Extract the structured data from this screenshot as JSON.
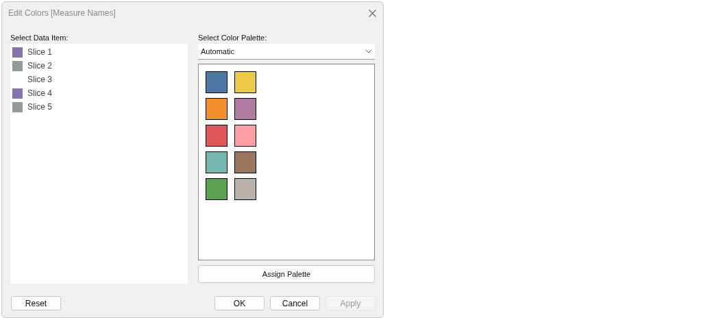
{
  "window": {
    "title": "Edit Colors [Measure Names]"
  },
  "data_items": {
    "label": "Select Data Item:",
    "items": [
      {
        "name": "Slice 1",
        "color": "#8175aa"
      },
      {
        "name": "Slice 2",
        "color": "#949a9b"
      },
      {
        "name": "Slice 3"
      },
      {
        "name": "Slice 4",
        "color": "#8175aa"
      },
      {
        "name": "Slice 5",
        "color": "#949a9b"
      }
    ]
  },
  "palette": {
    "label": "Select Color Palette:",
    "value": "Automatic",
    "swatches": [
      {
        "color": "#4e79a7"
      },
      {
        "color": "#edc948"
      },
      {
        "color": "#f28e2b"
      },
      {
        "color": "#b07aa1"
      },
      {
        "color": "#e15759"
      },
      {
        "color": "#ff9da7"
      },
      {
        "color": "#76b7b2"
      },
      {
        "color": "#9c755f"
      },
      {
        "color": "#59a14f"
      },
      {
        "color": "#bab0ac"
      }
    ],
    "assign_button": "Assign Palette"
  },
  "buttons": [
    {
      "label": "Reset",
      "disabled": false
    },
    {
      "label": "OK",
      "disabled": false
    },
    {
      "label": "Cancel",
      "disabled": false
    },
    {
      "label": "Apply",
      "disabled": true
    }
  ]
}
